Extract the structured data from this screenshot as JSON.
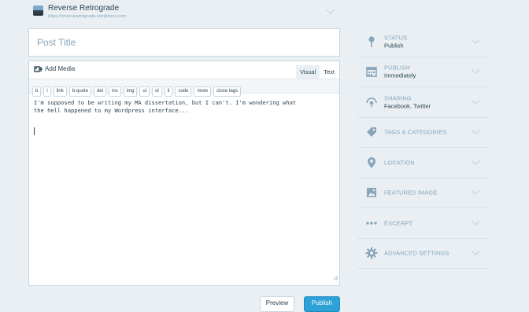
{
  "site": {
    "title": "Reverse Retrograde",
    "url": "https://reverseretrograde.wordpress.com"
  },
  "post": {
    "title_placeholder": "Post Title",
    "content": "I'm supposed to be writing my MA dissertation, but I can't. I'm wondering what\nthe hell happened to my Wordpress interface..."
  },
  "editor": {
    "add_media_label": "Add Media",
    "tab_visual": "Visual",
    "tab_text": "Text",
    "quicktags": [
      "b",
      "i",
      "link",
      "b-quote",
      "del",
      "ins",
      "img",
      "ul",
      "ol",
      "li",
      "code",
      "more",
      "close tags"
    ]
  },
  "buttons": {
    "preview": "Preview",
    "publish": "Publish"
  },
  "sidebar": {
    "panels": [
      {
        "icon": "pushpin-icon",
        "label": "STATUS",
        "value": "Publish"
      },
      {
        "icon": "calendar-icon",
        "label": "PUBLISH",
        "value": "Immediately"
      },
      {
        "icon": "share-icon",
        "label": "SHARING",
        "value": "Facebook, Twitter"
      },
      {
        "icon": "tag-icon",
        "label": "TAGS & CATEGORIES",
        "value": ""
      },
      {
        "icon": "location-icon",
        "label": "LOCATION",
        "value": ""
      },
      {
        "icon": "image-icon",
        "label": "FEATURED IMAGE",
        "value": ""
      },
      {
        "icon": "ellipsis-icon",
        "label": "EXCERPT",
        "value": ""
      },
      {
        "icon": "gear-icon",
        "label": "ADVANCED SETTINGS",
        "value": ""
      }
    ]
  },
  "colors": {
    "background": "#e9eff3",
    "text": "#2e4453",
    "muted": "#87a6bc",
    "accent": "#2ea2d6",
    "border": "#c8d7e1"
  }
}
